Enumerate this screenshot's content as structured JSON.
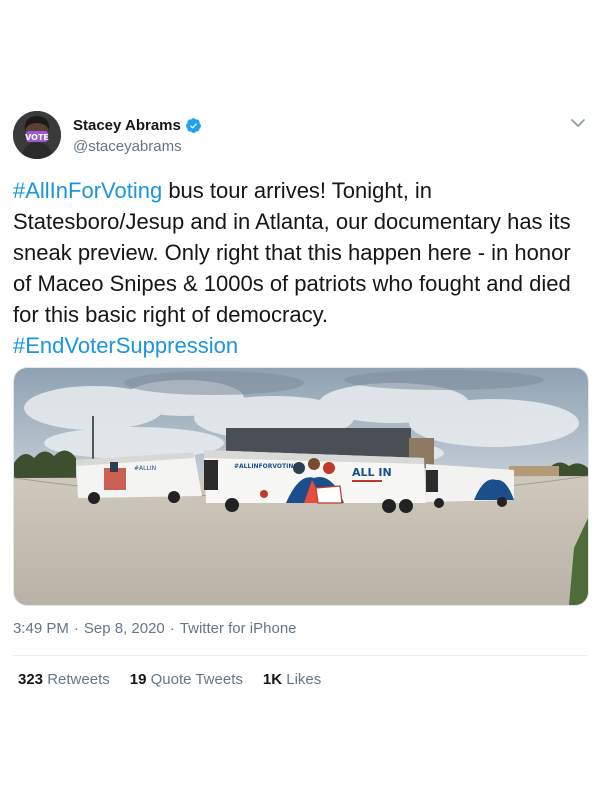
{
  "author": {
    "display_name": "Stacey Abrams",
    "handle": "@staceyabrams",
    "avatar_badge": "VOTE"
  },
  "tweet": {
    "hashtag_start": "#AllInForVoting",
    "body": " bus tour arrives! Tonight, in Statesboro/Jesup and in Atlanta, our documentary has its sneak preview. Only right that this happen here - in honor of Maceo Snipes & 1000s of patriots who fought and died for this basic right of democracy.",
    "hashtag_end": "#EndVoterSuppression"
  },
  "media": {
    "bus_logo_text": "ALL IN",
    "bus_hashtag": "#ALLINFORVOTING"
  },
  "meta": {
    "time": "3:49 PM",
    "separator_1": "·",
    "date": "Sep 8, 2020",
    "separator_2": "·",
    "source": "Twitter for iPhone"
  },
  "stats": {
    "retweets_count": "323",
    "retweets_label": "Retweets",
    "quotes_count": "19",
    "quotes_label": "Quote Tweets",
    "likes_count": "1K",
    "likes_label": "Likes"
  },
  "colors": {
    "link": "#1b95e0",
    "verified": "#1da1f2",
    "secondary_text": "#657786",
    "primary_text": "#14171a",
    "badge_purple": "#9b59d6"
  }
}
